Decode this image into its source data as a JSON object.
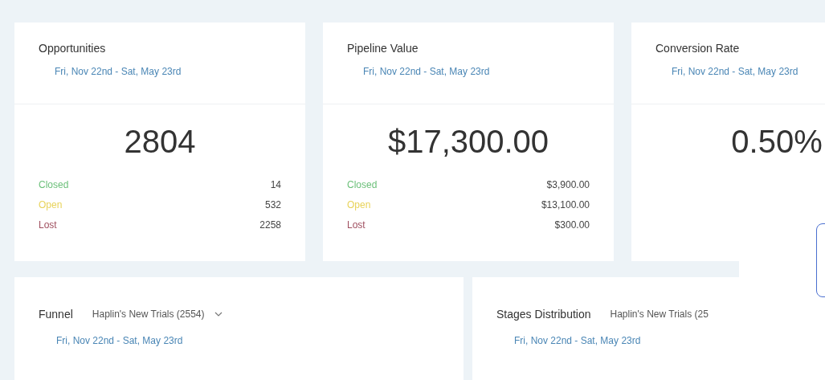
{
  "metrics": [
    {
      "title": "Opportunities",
      "date_range": "Fri, Nov 22nd - Sat, May 23rd",
      "total": "2804",
      "breakdown": [
        {
          "label": "Closed",
          "value": "14",
          "color": "#6cc07a"
        },
        {
          "label": "Open",
          "value": "532",
          "color": "#e8d35a"
        },
        {
          "label": "Lost",
          "value": "2258",
          "color": "#a05060"
        }
      ]
    },
    {
      "title": "Pipeline Value",
      "date_range": "Fri, Nov 22nd - Sat, May 23rd",
      "total": "$17,300.00",
      "breakdown": [
        {
          "label": "Closed",
          "value": "$3,900.00",
          "color": "#6cc07a"
        },
        {
          "label": "Open",
          "value": "$13,100.00",
          "color": "#e8d35a"
        },
        {
          "label": "Lost",
          "value": "$300.00",
          "color": "#a05060"
        }
      ]
    },
    {
      "title": "Conversion Rate",
      "date_range": "Fri, Nov 22nd - Sat, May 23rd",
      "total": "0.50%"
    }
  ],
  "panels": [
    {
      "title": "Funnel",
      "filter": "Haplin's New Trials (2554)",
      "dropdown": true,
      "date_range": "Fri, Nov 22nd - Sat, May 23rd"
    },
    {
      "title": "Stages Distribution",
      "filter": "Haplin's New Trials (25",
      "dropdown": false,
      "date_range": "Fri, Nov 22nd - Sat, May 23rd"
    }
  ]
}
